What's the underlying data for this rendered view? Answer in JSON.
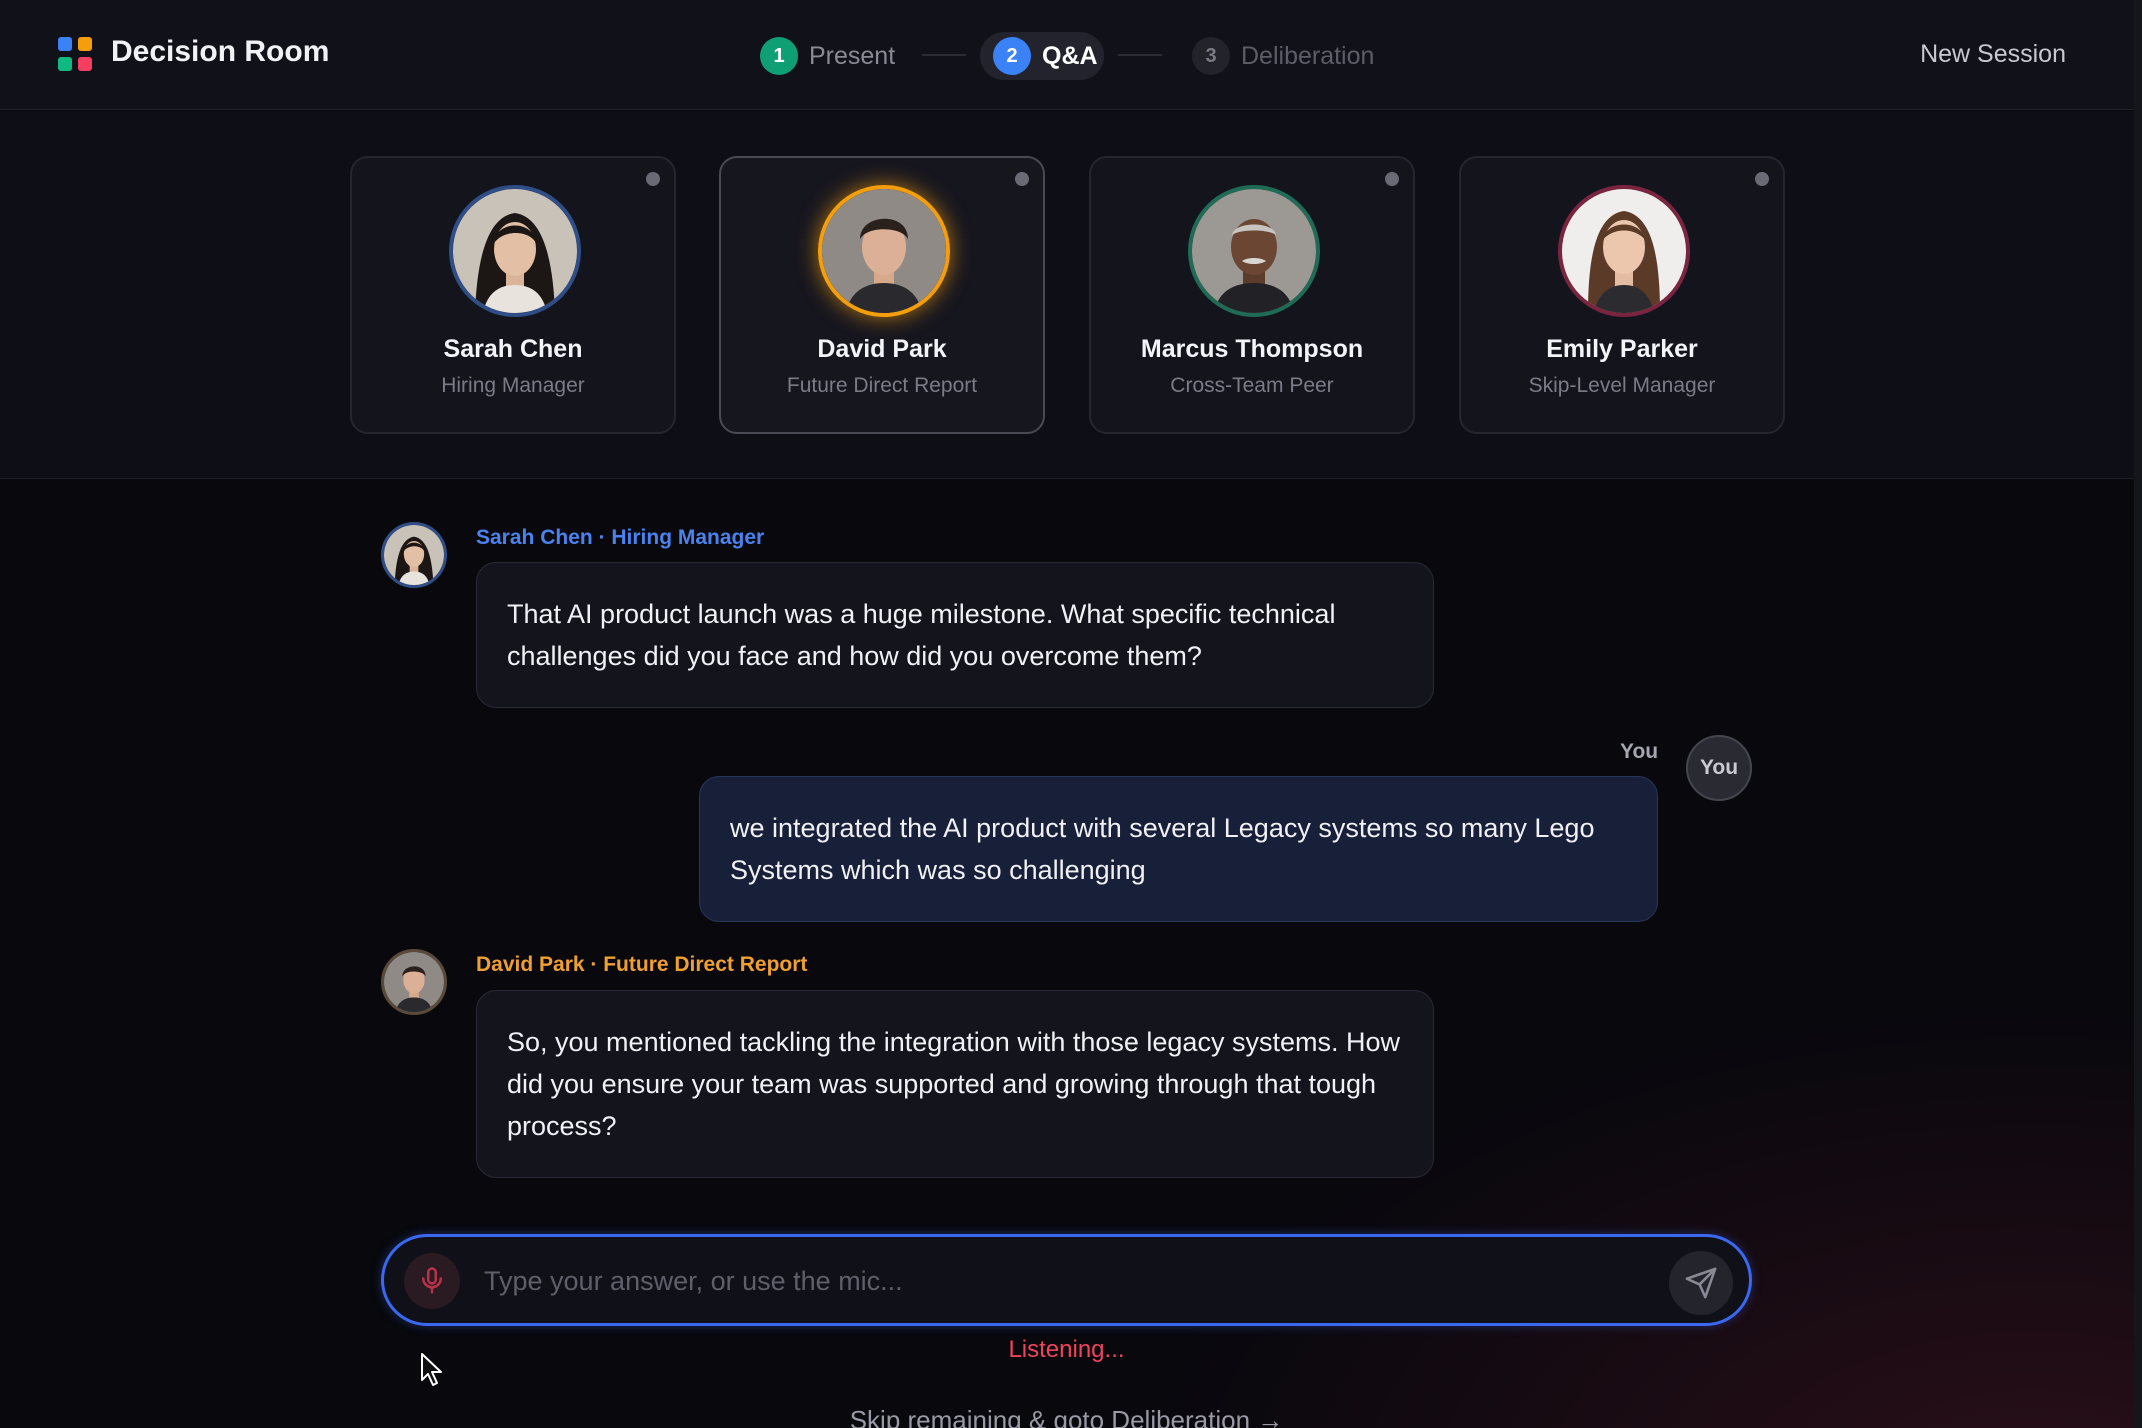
{
  "header": {
    "app_title": "Decision Room",
    "steps": [
      {
        "num": "1",
        "label": "Present",
        "state": "done"
      },
      {
        "num": "2",
        "label": "Q&A",
        "state": "active"
      },
      {
        "num": "3",
        "label": "Deliberation",
        "state": "upcoming"
      }
    ],
    "new_session_label": "New Session"
  },
  "panel": {
    "members": [
      {
        "name": "Sarah Chen",
        "role": "Hiring Manager",
        "ring_color": "#2f4d86",
        "active": false
      },
      {
        "name": "David Park",
        "role": "Future Direct Report",
        "ring_color": "#f59e0b",
        "active": true
      },
      {
        "name": "Marcus Thompson",
        "role": "Cross-Team Peer",
        "ring_color": "#1f6b55",
        "active": false
      },
      {
        "name": "Emily Parker",
        "role": "Skip-Level Manager",
        "ring_color": "#7a2440",
        "active": false
      }
    ]
  },
  "chat": {
    "messages": [
      {
        "speaker": "Sarah Chen · Hiring Manager",
        "speaker_color": "#4a82f0",
        "text": "That AI product launch was a huge milestone. What specific technical challenges did you face and how did you overcome them?"
      },
      {
        "speaker": "You",
        "avatar_label": "You",
        "text": "we integrated the AI product with several Legacy systems so many Lego Systems which was so challenging"
      },
      {
        "speaker": "David Park · Future Direct Report",
        "speaker_color": "#f0a030",
        "text": "So, you mentioned tackling the integration with those legacy systems. How did you ensure your team was supported and growing through that tough process?"
      }
    ]
  },
  "composer": {
    "placeholder": "Type your answer, or use the mic...",
    "status": "Listening...",
    "skip_label": "Skip remaining & goto Deliberation →"
  },
  "colors": {
    "accent": "#3b82f6",
    "listening": "#f0435e",
    "background": "#08080d"
  }
}
